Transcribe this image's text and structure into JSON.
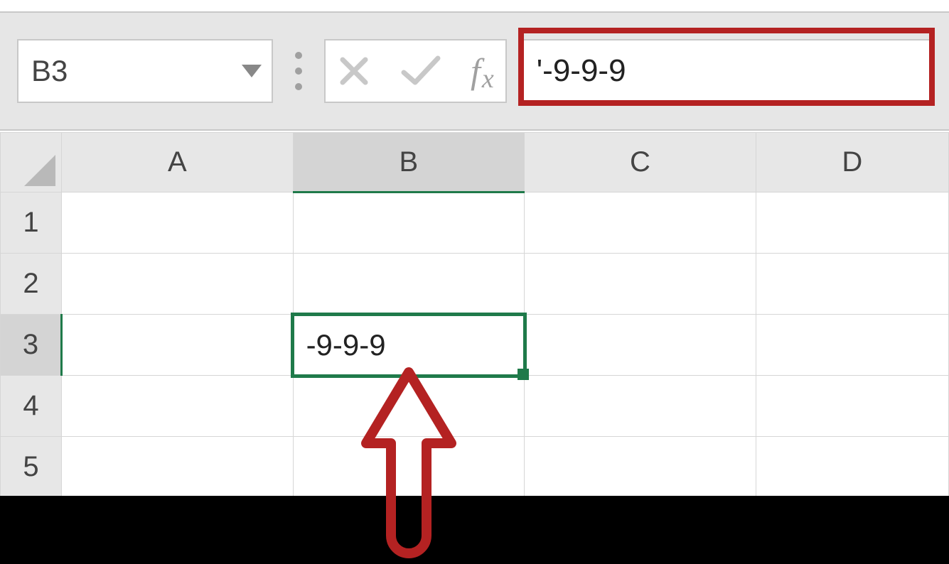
{
  "name_box": {
    "value": "B3"
  },
  "formula_bar": {
    "value": "'-9-9-9"
  },
  "columns": [
    "A",
    "B",
    "C",
    "D"
  ],
  "rows": [
    "1",
    "2",
    "3",
    "4",
    "5"
  ],
  "selected": {
    "col_index": 1,
    "row_index": 2
  },
  "cells": {
    "B3": "-9-9-9"
  },
  "icons": {
    "dropdown": "dropdown-triangle-icon",
    "cancel": "cancel-x-icon",
    "confirm": "confirm-check-icon",
    "fx": "fx-icon"
  }
}
